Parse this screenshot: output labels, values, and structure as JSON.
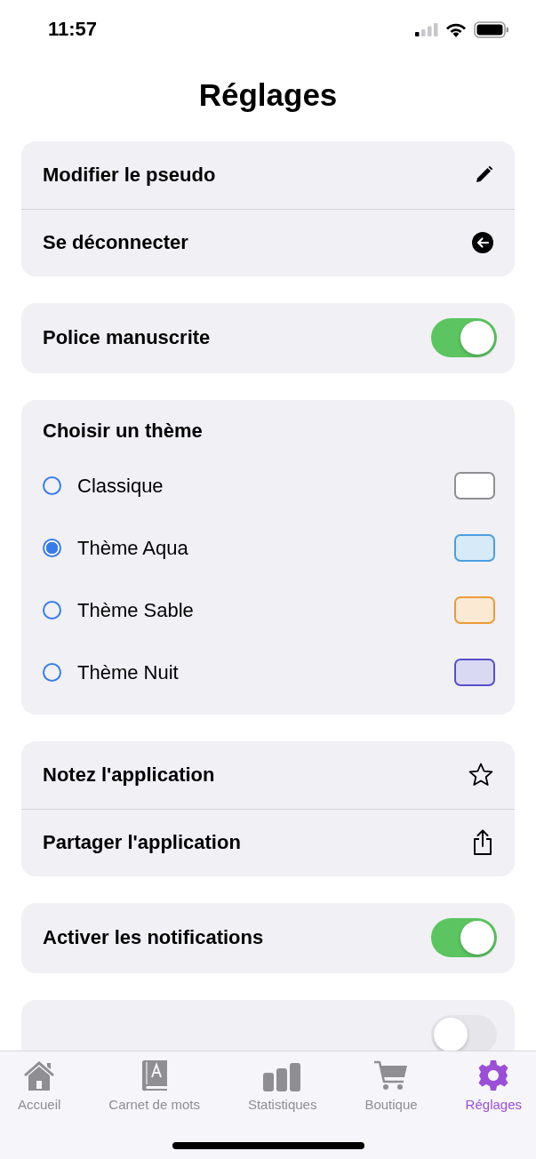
{
  "status_bar": {
    "time": "11:57"
  },
  "title": "Réglages",
  "sections": [
    {
      "kind": "actions",
      "rows": [
        {
          "label": "Modifier le pseudo"
        },
        {
          "label": "Se déconnecter"
        }
      ]
    },
    {
      "kind": "toggle",
      "rows": [
        {
          "label": "Police manuscrite",
          "on": true
        }
      ]
    },
    {
      "kind": "themes",
      "heading": "Choisir un thème",
      "options": [
        {
          "label": "Classique",
          "selected": false,
          "color": "#8e8e93"
        },
        {
          "label": "Thème Aqua",
          "selected": true,
          "color": "#4a9fe0"
        },
        {
          "label": "Thème Sable",
          "selected": false,
          "color": "#eb9a3a"
        },
        {
          "label": "Thème Nuit",
          "selected": false,
          "color": "#5650c8"
        }
      ]
    },
    {
      "kind": "actions",
      "rows": [
        {
          "label": "Notez l'application"
        },
        {
          "label": "Partager l'application"
        }
      ]
    },
    {
      "kind": "toggle",
      "rows": [
        {
          "label": "Activer les notifications",
          "on": true
        }
      ]
    },
    {
      "kind": "toggle",
      "rows": [
        {
          "on": false
        }
      ]
    }
  ],
  "tab_bar": [
    {
      "label": "Accueil",
      "selected": false
    },
    {
      "label": "Carnet de mots",
      "selected": false
    },
    {
      "label": "Statistiques",
      "selected": false
    },
    {
      "label": "Boutique",
      "selected": false
    },
    {
      "label": "Réglages",
      "selected": true
    }
  ]
}
